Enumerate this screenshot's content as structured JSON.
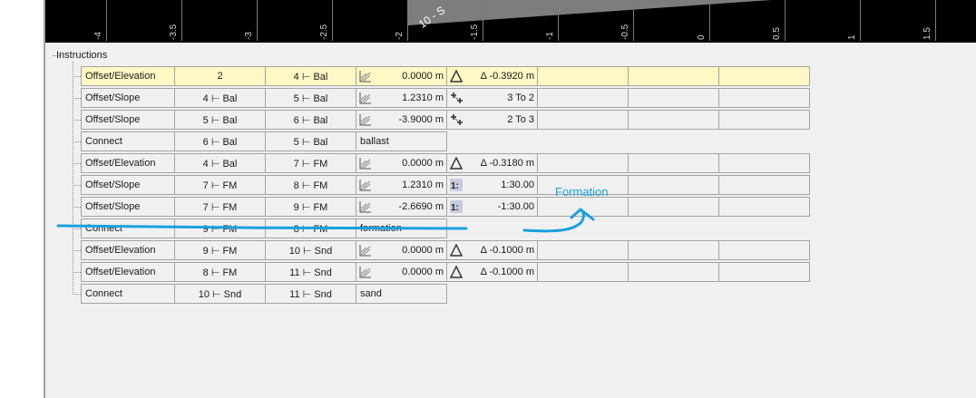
{
  "ruler": {
    "labels": [
      "-4",
      "-3.5",
      "-3",
      "-2.5",
      "-2",
      "-1.5",
      "-1",
      "-0.5",
      "0",
      "0.5",
      "1",
      "1.5"
    ],
    "diagonal_text": "10 - S"
  },
  "tree": {
    "root_label": "Instructions"
  },
  "rows": [
    {
      "type": "Offset/Elevation",
      "p1": "2",
      "p2": "4 ⊢ Bal",
      "value": "0.0000 m",
      "value_icon": "slope-icon",
      "aux": "Δ -0.3920 m",
      "aux_icon": "triangle-icon",
      "selected": true
    },
    {
      "type": "Offset/Slope",
      "p1": "4 ⊢ Bal",
      "p2": "5 ⊢ Bal",
      "value": "1.2310 m",
      "value_icon": "slope-icon",
      "aux": "3 To 2",
      "aux_icon": "ratio-cross-icon"
    },
    {
      "type": "Offset/Slope",
      "p1": "5 ⊢ Bal",
      "p2": "6 ⊢ Bal",
      "value": "-3.9000 m",
      "value_icon": "slope-icon",
      "aux": "2 To 3",
      "aux_icon": "ratio-cross-icon"
    },
    {
      "type": "Connect",
      "p1": "6 ⊢ Bal",
      "p2": "5 ⊢ Bal",
      "value": "ballast",
      "value_icon": "",
      "aux": "",
      "aux_icon": "",
      "connect": true
    },
    {
      "type": "Offset/Elevation",
      "p1": "4 ⊢ Bal",
      "p2": "7 ⊢ FM",
      "value": "0.0000 m",
      "value_icon": "slope-icon",
      "aux": "Δ -0.3180 m",
      "aux_icon": "triangle-icon"
    },
    {
      "type": "Offset/Slope",
      "p1": "7 ⊢ FM",
      "p2": "8 ⊢ FM",
      "value": "1.2310 m",
      "value_icon": "slope-icon",
      "aux": "1:30.00",
      "aux_icon": "grade-ratio-icon"
    },
    {
      "type": "Offset/Slope",
      "p1": "7 ⊢ FM",
      "p2": "9 ⊢ FM",
      "value": "-2.6690 m",
      "value_icon": "slope-icon",
      "aux": "-1:30.00",
      "aux_icon": "grade-ratio-icon"
    },
    {
      "type": "Connect",
      "p1": "9 ⊢ FM",
      "p2": "8 ⊢ FM",
      "value": "formation",
      "value_icon": "",
      "aux": "",
      "aux_icon": "",
      "connect": true
    },
    {
      "type": "Offset/Elevation",
      "p1": "9 ⊢ FM",
      "p2": "10 ⊢ Snd",
      "value": "0.0000 m",
      "value_icon": "slope-icon",
      "aux": "Δ -0.1000 m",
      "aux_icon": "triangle-icon"
    },
    {
      "type": "Offset/Elevation",
      "p1": "8 ⊢ FM",
      "p2": "11 ⊢ Snd",
      "value": "0.0000 m",
      "value_icon": "slope-icon",
      "aux": "Δ -0.1000 m",
      "aux_icon": "triangle-icon"
    },
    {
      "type": "Connect",
      "p1": "10 ⊢ Snd",
      "p2": "11 ⊢ Snd",
      "value": "sand",
      "value_icon": "",
      "aux": "",
      "aux_icon": "",
      "connect": true
    }
  ],
  "annotation": {
    "text": "Formation",
    "color": "#1aa0dc"
  },
  "colors": {
    "selected_row": "#fff8c4",
    "panel": "#f0f0f0",
    "annotation": "#1aa0dc"
  }
}
